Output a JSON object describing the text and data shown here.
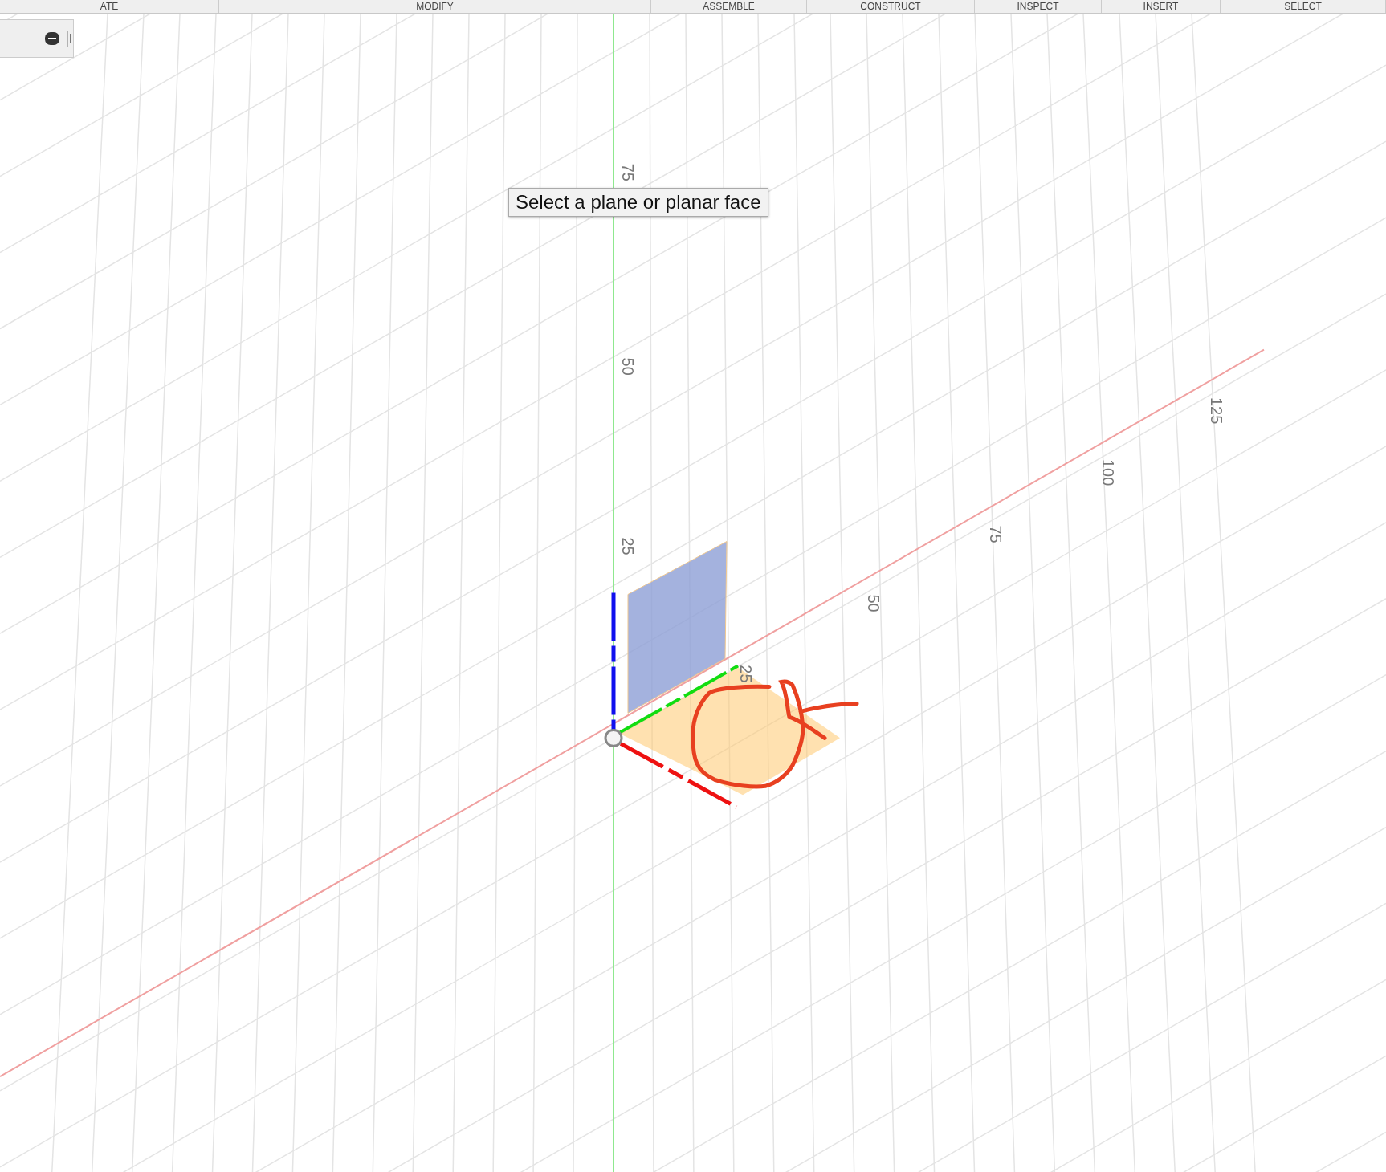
{
  "toolbar": {
    "tabs": [
      {
        "label": "ATE"
      },
      {
        "label": "MODIFY"
      },
      {
        "label": "ASSEMBLE"
      },
      {
        "label": "CONSTRUCT"
      },
      {
        "label": "INSPECT"
      },
      {
        "label": "INSERT"
      },
      {
        "label": "SELECT"
      }
    ]
  },
  "viewport": {
    "vertical_axis_labels": [
      "75",
      "50",
      "25"
    ],
    "horizontal_axis_labels": [
      "25",
      "50",
      "75",
      "100",
      "125"
    ],
    "tooltip": "Select a plane or planar face"
  }
}
